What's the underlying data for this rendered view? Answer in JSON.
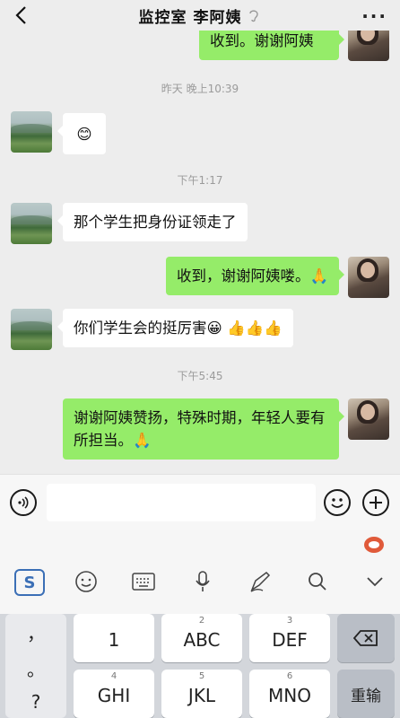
{
  "header": {
    "title": "监控室  李阿姨"
  },
  "chat": {
    "messages": [
      {
        "type": "out",
        "text": "收到。谢谢阿姨"
      },
      {
        "type": "time",
        "text": "昨天 晚上10:39"
      },
      {
        "type": "in",
        "text": "😊"
      },
      {
        "type": "time",
        "text": "下午1:17"
      },
      {
        "type": "in",
        "text": "那个学生把身份证领走了"
      },
      {
        "type": "out",
        "text": "收到，谢谢阿姨喽。🙏"
      },
      {
        "type": "in",
        "text": "你们学生会的挺厉害😀 👍👍👍"
      },
      {
        "type": "time",
        "text": "下午5:45"
      },
      {
        "type": "out",
        "text": "谢谢阿姨赞扬，特殊时期，年轻人要有所担当。🙏"
      }
    ]
  },
  "input": {
    "placeholder": ""
  },
  "keyboard": {
    "left_symbols": [
      "，",
      "。",
      "?"
    ],
    "row1": [
      {
        "num": "",
        "label": "1"
      },
      {
        "num": "2",
        "label": "ABC"
      },
      {
        "num": "3",
        "label": "DEF"
      }
    ],
    "row2": [
      {
        "num": "4",
        "label": "GHI"
      },
      {
        "num": "5",
        "label": "JKL"
      },
      {
        "num": "6",
        "label": "MNO"
      }
    ],
    "retype_label": "重输",
    "sogou_label": "S"
  },
  "colors": {
    "outgoing_bubble": "#95ec69",
    "incoming_bubble": "#ffffff",
    "background": "#ededed"
  }
}
